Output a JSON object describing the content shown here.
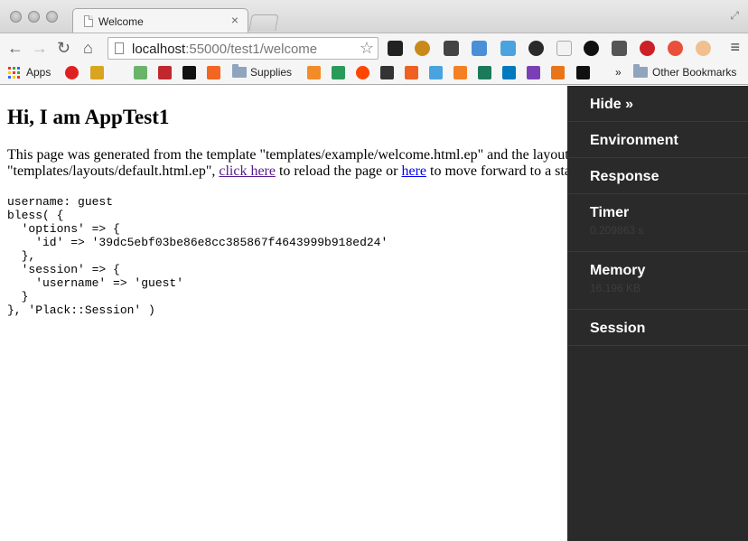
{
  "tab": {
    "title": "Welcome"
  },
  "address_bar": {
    "host": "localhost",
    "path": ":55000/test1/welcome"
  },
  "bookmarks": {
    "apps": "Apps",
    "supplies": "Supplies",
    "more": "»",
    "other": "Other Bookmarks"
  },
  "page": {
    "heading": "Hi, I am AppTest1",
    "para_1": "This page was generated from the template \"templates/example/welcome.html.ep\" and the layout \"templates/layouts/default.html.ep\", ",
    "link_reload": "click here",
    "para_2": " to reload the page or ",
    "link_forward": "here",
    "para_3": " to move forward to a static page. Dynamic",
    "dump": "username: guest\nbless( {\n  'options' => {\n    'id' => '39dc5ebf03be86e8cc385867f4643999b918ed24'\n  },\n  'session' => {\n    'username' => 'guest'\n  }\n}, 'Plack::Session' )"
  },
  "panel": {
    "hide": "Hide »",
    "environment": "Environment",
    "response": "Response",
    "timer": "Timer",
    "timer_value": "0.209863 s",
    "memory": "Memory",
    "memory_value": "16,196 KB",
    "session": "Session"
  }
}
